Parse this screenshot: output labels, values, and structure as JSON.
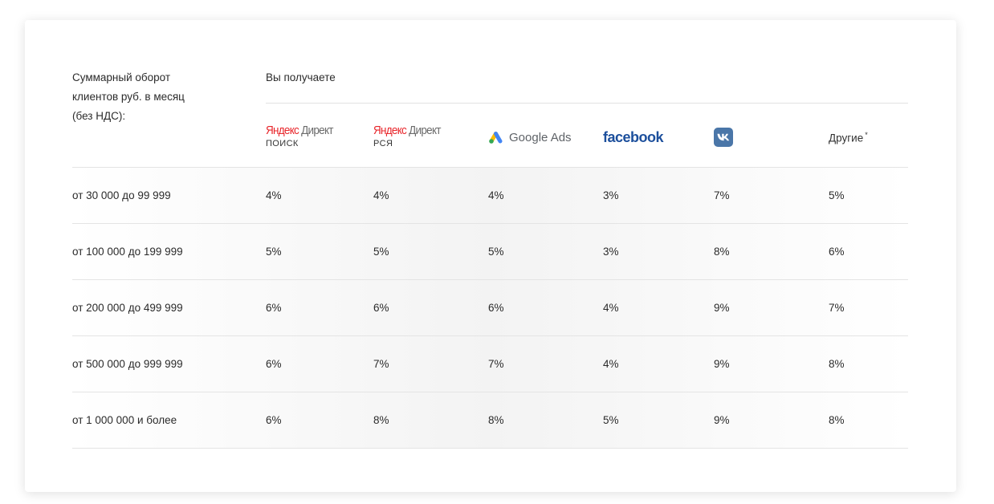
{
  "header": {
    "left_label_lines": [
      "Суммарный оборот",
      "клиентов руб. в месяц",
      "(без НДС):"
    ],
    "you_get_label": "Вы получаете"
  },
  "columns": [
    {
      "id": "yandex-search",
      "brand_red": "Я",
      "brand_red2": "ндекс",
      "brand_grey": " Директ",
      "sub": "ПОИСК",
      "icon": "yandex-direct-logo"
    },
    {
      "id": "yandex-rsya",
      "brand_red": "Я",
      "brand_red2": "ндекс",
      "brand_grey": " Директ",
      "sub": "РСЯ",
      "icon": "yandex-direct-logo"
    },
    {
      "id": "google-ads",
      "label": "Google Ads",
      "icon": "google-ads-logo"
    },
    {
      "id": "facebook",
      "label": "facebook",
      "icon": "facebook-logo"
    },
    {
      "id": "vk",
      "icon": "vk-logo"
    },
    {
      "id": "other",
      "label": "Другие",
      "footnote": "*"
    }
  ],
  "rows": [
    {
      "range": "от 30 000 до 99 999",
      "values": [
        "4%",
        "4%",
        "4%",
        "3%",
        "7%",
        "5%"
      ]
    },
    {
      "range": "от 100 000 до 199 999",
      "values": [
        "5%",
        "5%",
        "5%",
        "3%",
        "8%",
        "6%"
      ]
    },
    {
      "range": "от 200 000 до 499 999",
      "values": [
        "6%",
        "6%",
        "6%",
        "4%",
        "9%",
        "7%"
      ]
    },
    {
      "range": "от 500 000 до 999 999",
      "values": [
        "6%",
        "7%",
        "7%",
        "4%",
        "9%",
        "8%"
      ]
    },
    {
      "range": "от 1 000 000 и более",
      "values": [
        "6%",
        "8%",
        "8%",
        "5%",
        "9%",
        "8%"
      ]
    }
  ],
  "colors": {
    "yandex_red": "#e8262b",
    "facebook_blue": "#1c4f9c",
    "vk_blue": "#4a76a8"
  }
}
